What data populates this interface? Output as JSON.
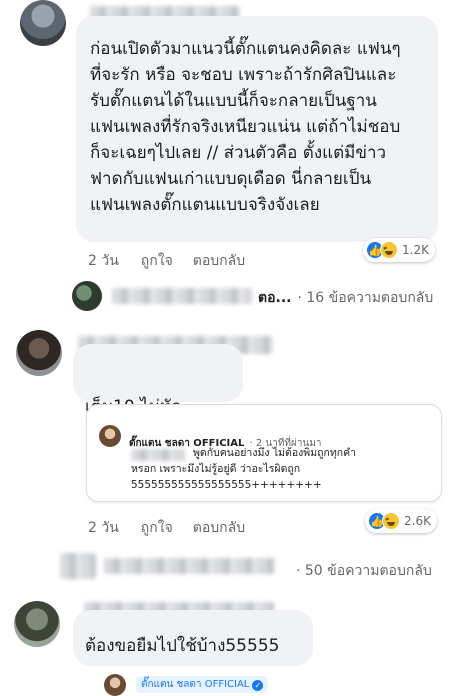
{
  "comment1": {
    "text": "ก่อนเปิดตัวมาแนวนี้ตั๊กแตนคงคิดละ แฟนๆ\nที่จะรัก หรือ จะชอบ เพราะถ้ารักศิลปินและ\nรับตั๊กแตนได้ในแบบนี้ก็จะกลายเป็นฐาน\nแฟนเพลงที่รักจริงเหนียวแน่น แต่ถ้าไม่ชอบ\nก็จะเฉยๆไปเลย // ส่วนตัวคือ ตั้งแต่มีข่าว\nฟาดกับแฟนเก่าแบบดุเดือด นี่กลายเป็น\nแฟนเพลงตั๊กแตนแบบจริงจังเลย",
    "time": "2 วัน",
    "like": "ถูกใจ",
    "reply": "ตอบกลับ",
    "reactions": "1.2K",
    "reply_author_suffix": "ตอ...",
    "reply_count": "· 16 ข้อความตอบกลับ"
  },
  "comment2": {
    "text": "เต็ม10 ไม่หัก",
    "time": "2 วัน",
    "like": "ถูกใจ",
    "reply": "ตอบกลับ",
    "reactions": "2.6K"
  },
  "page_reply": {
    "author": "ตั๊กแตน ชลดา OFFICIAL",
    "time": "· 2 นาทีที่ผ่านมา",
    "text": "พูดกับคนอย่างมึง ไม่ต้องพิมถูกทุกคำ\nหรอก เพราะมึงไม่รู้อยู่ดี ว่าอะไรผิดถูก\n555555555555555555++++++++"
  },
  "comment2_reply_count": "· 50 ข้อความตอบกลับ",
  "comment3": {
    "text": "ต้องขอยืมไปใช้บ้าง55555"
  },
  "page_tag": {
    "author": "ตั๊กแตน ชลดา OFFICIAL"
  },
  "colors": {
    "bubble": "#f0f2f5",
    "link_blue": "#1877f2",
    "meta_gray": "#65676b"
  }
}
